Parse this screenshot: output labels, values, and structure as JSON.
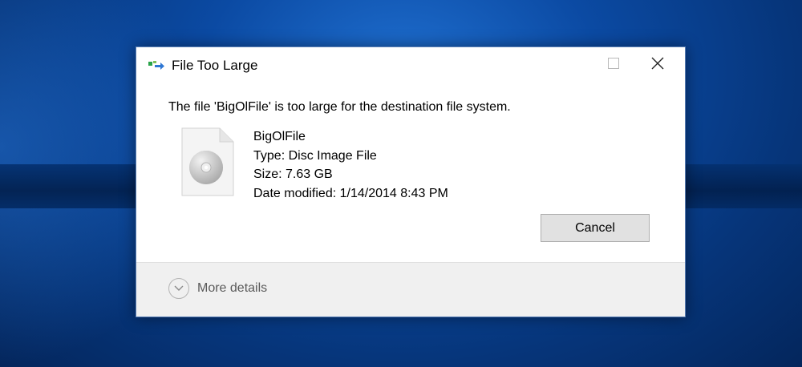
{
  "dialog": {
    "title": "File Too Large",
    "title_icon": "file-copy-icon",
    "message": "The file 'BigOlFile' is too large for the destination file system.",
    "file": {
      "icon": "disc-image-file-icon",
      "name": "BigOlFile",
      "type": "Type: Disc Image File",
      "size": "Size: 7.63 GB",
      "modified": "Date modified: 1/14/2014 8:43 PM"
    },
    "cancel_label": "Cancel",
    "more_details_label": "More details",
    "window_controls": [
      "minimize-icon",
      "maximize-icon",
      "close-icon"
    ]
  },
  "colors": {
    "desktop_blue": "#0b4aa3",
    "dialog_bg": "#ffffff",
    "footer_bg": "#f0f0f0",
    "button_bg": "#e1e1e1"
  }
}
